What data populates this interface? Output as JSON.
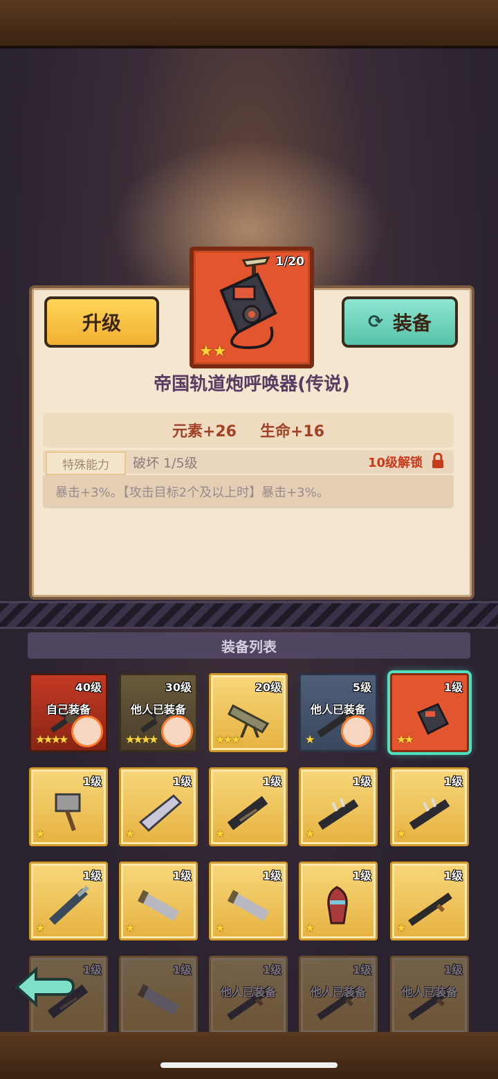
{
  "colors": {
    "accent_gold": "#f0b030",
    "accent_teal": "#55c2a8",
    "legend_red": "#e2552e",
    "selected_glow": "#4fe0c0"
  },
  "item": {
    "counter": "1/20",
    "name": "帝国轨道炮呼唤器(传说)",
    "stats": [
      "元素+26",
      "生命+16"
    ],
    "ability_tag": "特殊能力",
    "ability_name": "破坏  1/5级",
    "unlock_text": "10级解锁",
    "description": "暴击+3%。【攻击目标2个及以上时】暴击+3%。",
    "stars": 2
  },
  "buttons": {
    "upgrade": "升级",
    "equip": "装备",
    "equip_icon": "swap-icon"
  },
  "list": {
    "header": "装备列表",
    "slots": [
      {
        "level": "40级",
        "status": "自己装备",
        "stars": "★★★★",
        "style": "red",
        "weapon": "crossbow",
        "avatar": "avatar-red-hair"
      },
      {
        "level": "30级",
        "status": "他人已装备",
        "stars": "★★★★",
        "style": "olive",
        "weapon": "crossbow",
        "avatar": "avatar-white-hair"
      },
      {
        "level": "20级",
        "status": "",
        "stars": "★★★",
        "style": "gold",
        "weapon": "cannon"
      },
      {
        "level": "5级",
        "status": "他人已装备",
        "stars": "★",
        "style": "blue",
        "weapon": "rifle",
        "avatar": "avatar-monster"
      },
      {
        "level": "1级",
        "status": "",
        "stars": "★★",
        "style": "orange",
        "weapon": "summoner",
        "selected": true
      },
      {
        "level": "1级",
        "status": "",
        "stars": "★",
        "style": "gold",
        "weapon": "hammer"
      },
      {
        "level": "1级",
        "status": "",
        "stars": "★",
        "style": "gold",
        "weapon": "blade"
      },
      {
        "level": "1级",
        "status": "",
        "stars": "★",
        "style": "gold",
        "weapon": "gatling"
      },
      {
        "level": "1级",
        "status": "",
        "stars": "★",
        "style": "gold",
        "weapon": "spiked-gun"
      },
      {
        "level": "1级",
        "status": "",
        "stars": "★",
        "style": "gold",
        "weapon": "spiked-gun"
      },
      {
        "level": "1级",
        "status": "",
        "stars": "★",
        "style": "gold",
        "weapon": "drill-gun"
      },
      {
        "level": "1级",
        "status": "",
        "stars": "★",
        "style": "gold",
        "weapon": "bazooka"
      },
      {
        "level": "1级",
        "status": "",
        "stars": "★",
        "style": "gold",
        "weapon": "bazooka"
      },
      {
        "level": "1级",
        "status": "",
        "stars": "★",
        "style": "gold",
        "weapon": "shell"
      },
      {
        "level": "1级",
        "status": "",
        "stars": "★",
        "style": "gold",
        "weapon": "rifle"
      },
      {
        "level": "1级",
        "status": "",
        "stars": "",
        "style": "gold",
        "weapon": "gatling",
        "dim": true
      },
      {
        "level": "1级",
        "status": "",
        "stars": "",
        "style": "gold",
        "weapon": "bazooka",
        "dim": true
      },
      {
        "level": "1级",
        "status": "他人已装备",
        "stars": "",
        "style": "gold",
        "weapon": "rifle",
        "dim": true
      },
      {
        "level": "1级",
        "status": "他人已装备",
        "stars": "",
        "style": "gold",
        "weapon": "rifle",
        "dim": true
      },
      {
        "level": "1级",
        "status": "他人已装备",
        "stars": "",
        "style": "gold",
        "weapon": "rifle",
        "dim": true
      }
    ]
  },
  "nav": {
    "back_icon": "back-arrow-icon"
  }
}
